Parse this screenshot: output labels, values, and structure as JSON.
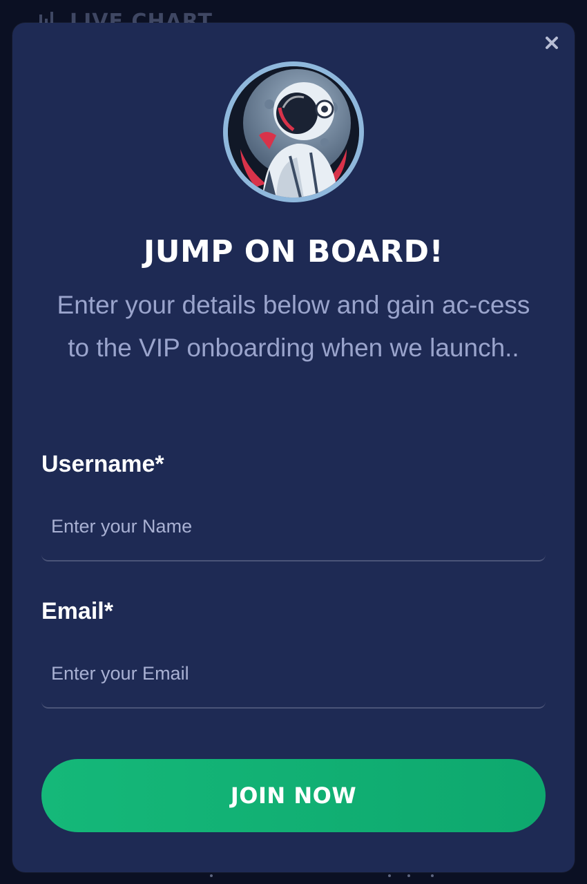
{
  "background": {
    "header_label": "LIVE CHART",
    "header_icon": "bar-chart-icon"
  },
  "modal": {
    "close_icon": "close-icon",
    "avatar_icon": "astronaut-icon",
    "title": "JUMP ON BOARD!",
    "subtitle": "Enter your details below and gain ac-cess to the VIP onboarding when we launch..",
    "username": {
      "label": "Username*",
      "placeholder": "Enter your Name",
      "value": ""
    },
    "email": {
      "label": "Email*",
      "placeholder": "Enter your Email",
      "value": ""
    },
    "submit_label": "JOIN NOW"
  },
  "colors": {
    "page_bg": "#0b1023",
    "modal_bg": "#1e2a54",
    "accent_green": "#15b879",
    "subtitle_text": "#9aa4cc",
    "avatar_ring": "#8fb8dc"
  }
}
